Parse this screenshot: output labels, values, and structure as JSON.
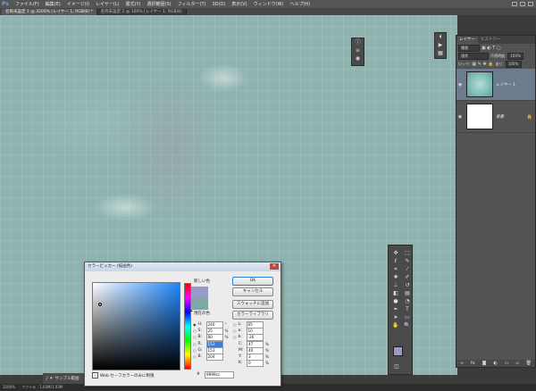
{
  "app": {
    "logo": "Ps"
  },
  "menu": [
    "ファイル(F)",
    "編集(E)",
    "イメージ(I)",
    "レイヤー(L)",
    "書式(Y)",
    "選択範囲(S)",
    "フィルター(T)",
    "3D(D)",
    "表示(V)",
    "ウィンドウ(W)",
    "ヘルプ(H)"
  ],
  "tabs": [
    {
      "label": "名称未設定 1 @ 3200% (レイヤー 1, RGB/8) *",
      "active": true
    },
    {
      "label": "名称未設定 2 @ 100% (レイヤー 1, RGB/8)",
      "active": false
    }
  ],
  "canvas": {
    "base_color": "#8fb4b0"
  },
  "layers_panel": {
    "tabs": [
      "レイヤー",
      "ヒストリー"
    ],
    "kind": "種類",
    "blend_mode": "通常",
    "opacity_label": "不透明度:",
    "opacity": "100%",
    "lock_label": "ロック:",
    "fill_label": "塗り:",
    "fill": "100%",
    "layers": [
      {
        "name": "レイヤー 1",
        "selected": true
      },
      {
        "name": "背景",
        "selected": false
      }
    ],
    "footer_icons": [
      "link-icon",
      "fx-icon",
      "mask-icon",
      "adjustment-icon",
      "folder-icon",
      "new-layer-icon",
      "trash-icon"
    ]
  },
  "tool_icons": [
    "move-icon",
    "marquee-icon",
    "lasso-icon",
    "quick-select-icon",
    "crop-icon",
    "eyedropper-icon",
    "healing-icon",
    "brush-icon",
    "stamp-icon",
    "history-brush-icon",
    "eraser-icon",
    "gradient-icon",
    "blur-icon",
    "dodge-icon",
    "pen-icon",
    "type-icon",
    "path-select-icon",
    "shape-icon",
    "hand-icon",
    "zoom-icon"
  ],
  "options_bar": {
    "tool_label": "サンプル範囲:"
  },
  "status_bar": {
    "zoom": "3200%",
    "doc": "ファイル : 1.03M/1.03M"
  },
  "color_picker": {
    "title": "カラーピッカー (描画色)",
    "new_label": "新しい色",
    "current_label": "現在の色",
    "new_color": "#9999cc",
    "current_color": "#7fa8a4",
    "buttons": {
      "ok": "OK",
      "cancel": "キャンセル",
      "add_swatch": "スウォッチに追加",
      "libraries": "カラーライブラリ"
    },
    "hsb": [
      {
        "label": "H:",
        "value": "240",
        "unit": "°"
      },
      {
        "label": "S:",
        "value": "25",
        "unit": "%"
      },
      {
        "label": "B:",
        "value": "80",
        "unit": "%"
      }
    ],
    "lab": [
      {
        "label": "L:",
        "value": "65"
      },
      {
        "label": "a:",
        "value": "10"
      },
      {
        "label": "b:",
        "value": "-26"
      }
    ],
    "rgb": [
      {
        "label": "R:",
        "value": "153",
        "selected": true
      },
      {
        "label": "G:",
        "value": "153",
        "selected": false
      },
      {
        "label": "B:",
        "value": "204",
        "selected": false
      }
    ],
    "cmyk": [
      {
        "label": "C:",
        "value": "47",
        "unit": "%"
      },
      {
        "label": "M:",
        "value": "40",
        "unit": "%"
      },
      {
        "label": "Y:",
        "value": "3",
        "unit": "%"
      },
      {
        "label": "K:",
        "value": "0",
        "unit": "%"
      }
    ],
    "hex_label": "#",
    "hex": "9999cc",
    "web_only_label": "Web セーフカラーのみに制限"
  }
}
